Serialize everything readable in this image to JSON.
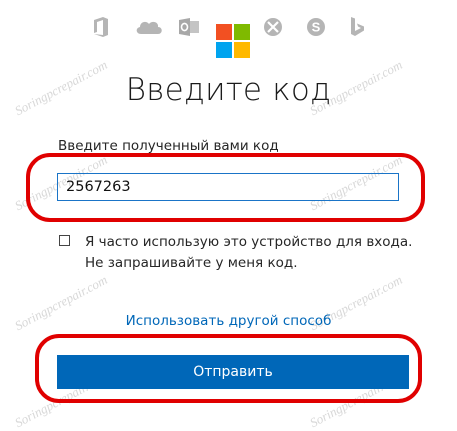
{
  "watermark": {
    "text": "Soringpcrepair.com"
  },
  "header": {
    "icons": [
      "office-icon",
      "onedrive-icon",
      "outlook-icon",
      "microsoft-logo",
      "xbox-icon",
      "skype-icon",
      "bing-icon"
    ]
  },
  "form": {
    "title": "Введите код",
    "code_label": "Введите полученный вами код",
    "code_value": "2567263",
    "remember_text": "Я часто использую это устройство для входа. Не запрашивайте у меня код.",
    "other_method_link": "Использовать другой способ",
    "submit_label": "Отправить"
  },
  "colors": {
    "accent": "#0067b8",
    "highlight": "#e00000",
    "logo": [
      "#f25022",
      "#7fba00",
      "#00a4ef",
      "#ffb900"
    ]
  }
}
